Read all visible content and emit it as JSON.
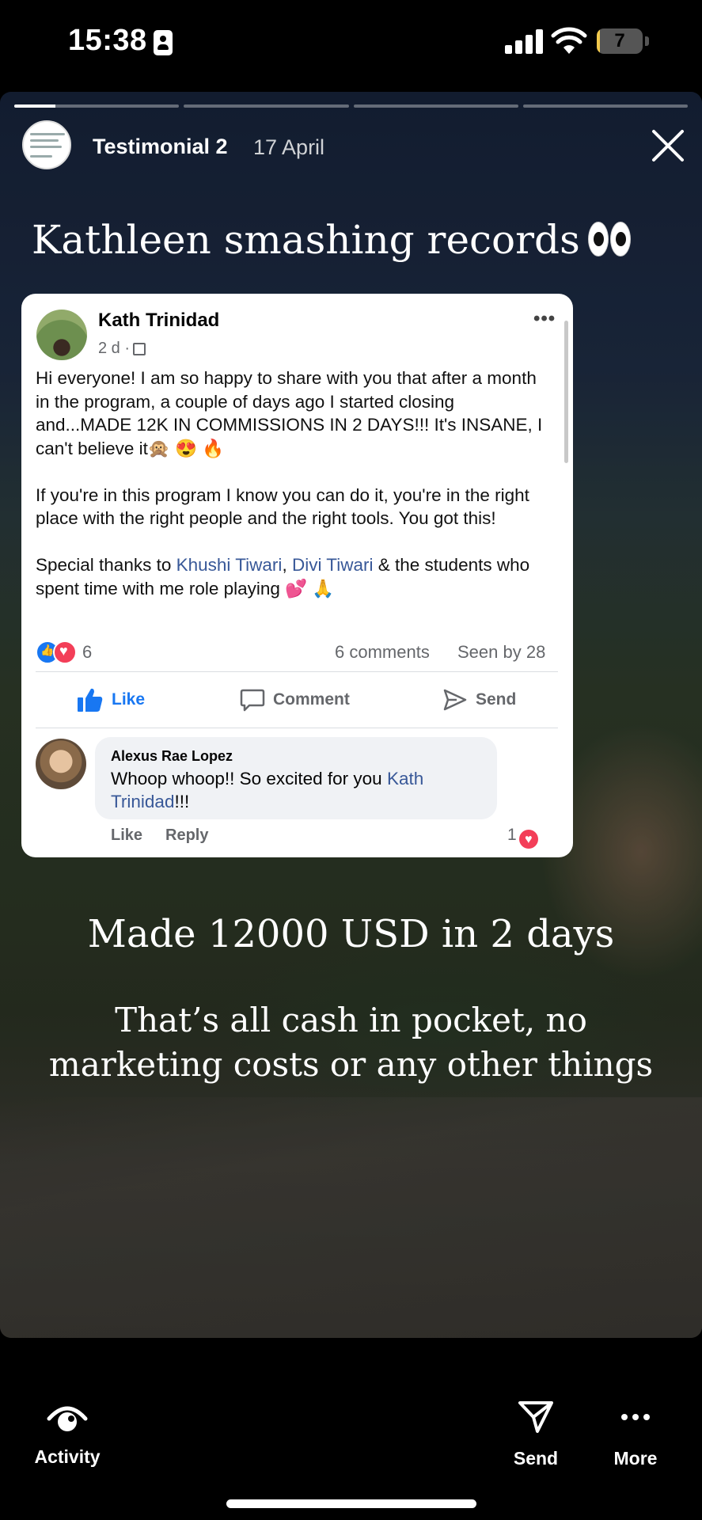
{
  "status_bar": {
    "time": "15:38",
    "battery": "7",
    "battery_level": 0.07
  },
  "story": {
    "title": "Testimonial 2",
    "date": "17 April",
    "progress": [
      0.25,
      0,
      0,
      0
    ],
    "headline": "Kathleen smashing records",
    "line1": "Made 12000 USD in 2 days",
    "line2a": "That’s all cash in pocket, no",
    "line2b": "marketing costs or any other things"
  },
  "post": {
    "author": "Kath Trinidad",
    "time": "2 d ·",
    "p1": "Hi everyone! I am so happy to share with you that after a month in the program, a couple of days ago I started closing and...MADE 12K IN COMMISSIONS IN 2 DAYS!!! It's INSANE, I can't believe it🙊 😍 🔥",
    "p2": "If you're in this program I know you can do it, you're in the right place with the right people and the right tools. You got this!",
    "p3_before": "Special thanks to",
    "mention1": "Khushi Tiwari",
    "p3_sep": ",",
    "mention2": "Divi Tiwari",
    "p3_after": "& the students who spent time with me role playing 💕 🙏",
    "reactions_count": "6",
    "comments_count": "6 comments",
    "seen_by": "Seen by 28",
    "actions": {
      "like": "Like",
      "comment": "Comment",
      "send": "Send"
    },
    "comment": {
      "name": "Alexus Rae Lopez",
      "text": "Whoop whoop!! So excited for you",
      "mention": "Kath Trinidad",
      "suffix": "!!!",
      "like": "Like",
      "reply": "Reply",
      "reactions": "1"
    }
  },
  "bottom_bar": {
    "activity": "Activity",
    "send": "Send",
    "more": "More"
  },
  "colors": {
    "link": "#385898",
    "like_blue": "#1877f2",
    "love_red": "#f33e58"
  }
}
